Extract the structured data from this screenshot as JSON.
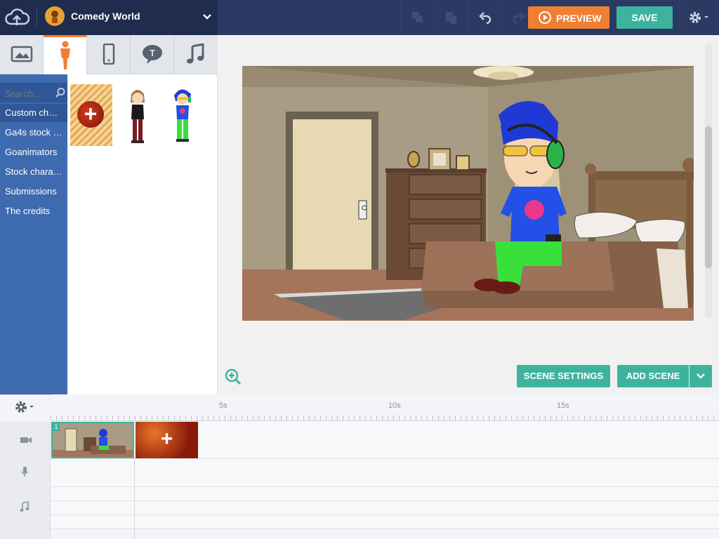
{
  "header": {
    "theme_name": "Comedy World",
    "preview_label": "PREVIEW",
    "save_label": "SAVE"
  },
  "asset_tabs": [
    "backgrounds-icon",
    "characters-icon",
    "props-icon",
    "text-bubbles-icon",
    "music-icon"
  ],
  "sidebar": {
    "search_placeholder": "Search...",
    "items": [
      {
        "label": "Custom char..."
      },
      {
        "label": "Ga4s stock c..."
      },
      {
        "label": "Goanimators"
      },
      {
        "label": "Stock charac..."
      },
      {
        "label": "Submissions"
      },
      {
        "label": "The credits"
      }
    ]
  },
  "stage_actions": {
    "scene_settings_label": "SCENE SETTINGS",
    "add_scene_label": "ADD SCENE"
  },
  "timeline": {
    "ticks": [
      "5s",
      "10s",
      "15s"
    ],
    "scene_number": "1"
  },
  "colors": {
    "accent_orange": "#f07e33",
    "accent_teal": "#3db39d",
    "header_bg": "#2a3a62",
    "sidebar_bg": "#3e6aaf"
  }
}
